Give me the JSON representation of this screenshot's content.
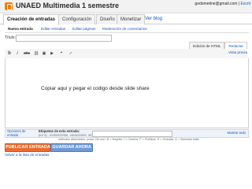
{
  "header": {
    "blog_title": "UNAED Multimedia 1 semestre",
    "user_email": "gedometine@gmail.com",
    "separator": " | ",
    "link": "Escrit"
  },
  "main_tabs": [
    {
      "label": "Creación de entradas"
    },
    {
      "label": "Configuración"
    },
    {
      "label": "Diseño"
    },
    {
      "label": "Monetizar"
    },
    {
      "label": "Ver blog"
    }
  ],
  "sub_tabs": [
    {
      "label": "Nueva entrada"
    },
    {
      "label": "Editar entradas"
    },
    {
      "label": "Editar páginas"
    },
    {
      "label": "Moderación de comentarios"
    }
  ],
  "title_field": {
    "label": "Título:",
    "value": ""
  },
  "mode_tabs": [
    {
      "label": "Edición de HTML"
    },
    {
      "label": "Redactar"
    }
  ],
  "toolbar": {
    "bold": "b",
    "italic": "i",
    "strike": "abc",
    "link": "⛓",
    "image": "▣",
    "video": "▶",
    "quote": "❝",
    "spell": "✓",
    "preview": "Vista previa"
  },
  "editor": {
    "content": "Copiar  aquí y pegar el codigo desde slide share"
  },
  "meta": {
    "options_label": "Opciones de",
    "options_label2": "entrada",
    "labels_title": "Etiquetas de esta entrada:",
    "labels_hint": "por ej., motocicletas, vacaciones, otoño",
    "show_all": "Mostrar todo"
  },
  "shortcuts": {
    "text": "métodos abreviados: pulse Ctrl con: B = Negrita, I = Cursiva, P = Publicar, S = Guardar, D = Borrador",
    "more": "más"
  },
  "buttons": {
    "publish": "PUBLICAR ENTRADA",
    "save": "GUARDAR AHORA"
  },
  "back_link": "Volver a la lista de entradas",
  "colors": {
    "publish": "#ec6b2d",
    "save": "#6f9ad8",
    "link": "#1155cc",
    "logo": "#f57c00"
  }
}
